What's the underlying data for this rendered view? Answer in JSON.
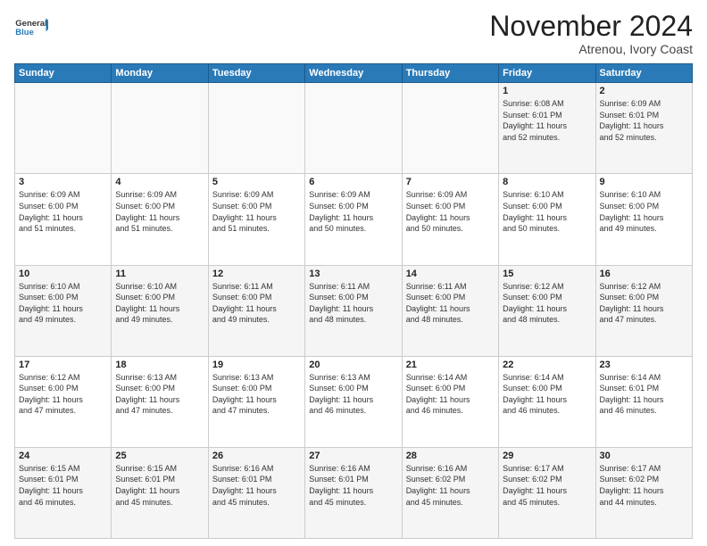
{
  "header": {
    "logo_general": "General",
    "logo_blue": "Blue",
    "month_title": "November 2024",
    "location": "Atrenou, Ivory Coast"
  },
  "days_of_week": [
    "Sunday",
    "Monday",
    "Tuesday",
    "Wednesday",
    "Thursday",
    "Friday",
    "Saturday"
  ],
  "weeks": [
    [
      {
        "day": "",
        "info": ""
      },
      {
        "day": "",
        "info": ""
      },
      {
        "day": "",
        "info": ""
      },
      {
        "day": "",
        "info": ""
      },
      {
        "day": "",
        "info": ""
      },
      {
        "day": "1",
        "info": "Sunrise: 6:08 AM\nSunset: 6:01 PM\nDaylight: 11 hours\nand 52 minutes."
      },
      {
        "day": "2",
        "info": "Sunrise: 6:09 AM\nSunset: 6:01 PM\nDaylight: 11 hours\nand 52 minutes."
      }
    ],
    [
      {
        "day": "3",
        "info": "Sunrise: 6:09 AM\nSunset: 6:00 PM\nDaylight: 11 hours\nand 51 minutes."
      },
      {
        "day": "4",
        "info": "Sunrise: 6:09 AM\nSunset: 6:00 PM\nDaylight: 11 hours\nand 51 minutes."
      },
      {
        "day": "5",
        "info": "Sunrise: 6:09 AM\nSunset: 6:00 PM\nDaylight: 11 hours\nand 51 minutes."
      },
      {
        "day": "6",
        "info": "Sunrise: 6:09 AM\nSunset: 6:00 PM\nDaylight: 11 hours\nand 50 minutes."
      },
      {
        "day": "7",
        "info": "Sunrise: 6:09 AM\nSunset: 6:00 PM\nDaylight: 11 hours\nand 50 minutes."
      },
      {
        "day": "8",
        "info": "Sunrise: 6:10 AM\nSunset: 6:00 PM\nDaylight: 11 hours\nand 50 minutes."
      },
      {
        "day": "9",
        "info": "Sunrise: 6:10 AM\nSunset: 6:00 PM\nDaylight: 11 hours\nand 49 minutes."
      }
    ],
    [
      {
        "day": "10",
        "info": "Sunrise: 6:10 AM\nSunset: 6:00 PM\nDaylight: 11 hours\nand 49 minutes."
      },
      {
        "day": "11",
        "info": "Sunrise: 6:10 AM\nSunset: 6:00 PM\nDaylight: 11 hours\nand 49 minutes."
      },
      {
        "day": "12",
        "info": "Sunrise: 6:11 AM\nSunset: 6:00 PM\nDaylight: 11 hours\nand 49 minutes."
      },
      {
        "day": "13",
        "info": "Sunrise: 6:11 AM\nSunset: 6:00 PM\nDaylight: 11 hours\nand 48 minutes."
      },
      {
        "day": "14",
        "info": "Sunrise: 6:11 AM\nSunset: 6:00 PM\nDaylight: 11 hours\nand 48 minutes."
      },
      {
        "day": "15",
        "info": "Sunrise: 6:12 AM\nSunset: 6:00 PM\nDaylight: 11 hours\nand 48 minutes."
      },
      {
        "day": "16",
        "info": "Sunrise: 6:12 AM\nSunset: 6:00 PM\nDaylight: 11 hours\nand 47 minutes."
      }
    ],
    [
      {
        "day": "17",
        "info": "Sunrise: 6:12 AM\nSunset: 6:00 PM\nDaylight: 11 hours\nand 47 minutes."
      },
      {
        "day": "18",
        "info": "Sunrise: 6:13 AM\nSunset: 6:00 PM\nDaylight: 11 hours\nand 47 minutes."
      },
      {
        "day": "19",
        "info": "Sunrise: 6:13 AM\nSunset: 6:00 PM\nDaylight: 11 hours\nand 47 minutes."
      },
      {
        "day": "20",
        "info": "Sunrise: 6:13 AM\nSunset: 6:00 PM\nDaylight: 11 hours\nand 46 minutes."
      },
      {
        "day": "21",
        "info": "Sunrise: 6:14 AM\nSunset: 6:00 PM\nDaylight: 11 hours\nand 46 minutes."
      },
      {
        "day": "22",
        "info": "Sunrise: 6:14 AM\nSunset: 6:00 PM\nDaylight: 11 hours\nand 46 minutes."
      },
      {
        "day": "23",
        "info": "Sunrise: 6:14 AM\nSunset: 6:01 PM\nDaylight: 11 hours\nand 46 minutes."
      }
    ],
    [
      {
        "day": "24",
        "info": "Sunrise: 6:15 AM\nSunset: 6:01 PM\nDaylight: 11 hours\nand 46 minutes."
      },
      {
        "day": "25",
        "info": "Sunrise: 6:15 AM\nSunset: 6:01 PM\nDaylight: 11 hours\nand 45 minutes."
      },
      {
        "day": "26",
        "info": "Sunrise: 6:16 AM\nSunset: 6:01 PM\nDaylight: 11 hours\nand 45 minutes."
      },
      {
        "day": "27",
        "info": "Sunrise: 6:16 AM\nSunset: 6:01 PM\nDaylight: 11 hours\nand 45 minutes."
      },
      {
        "day": "28",
        "info": "Sunrise: 6:16 AM\nSunset: 6:02 PM\nDaylight: 11 hours\nand 45 minutes."
      },
      {
        "day": "29",
        "info": "Sunrise: 6:17 AM\nSunset: 6:02 PM\nDaylight: 11 hours\nand 45 minutes."
      },
      {
        "day": "30",
        "info": "Sunrise: 6:17 AM\nSunset: 6:02 PM\nDaylight: 11 hours\nand 44 minutes."
      }
    ]
  ]
}
